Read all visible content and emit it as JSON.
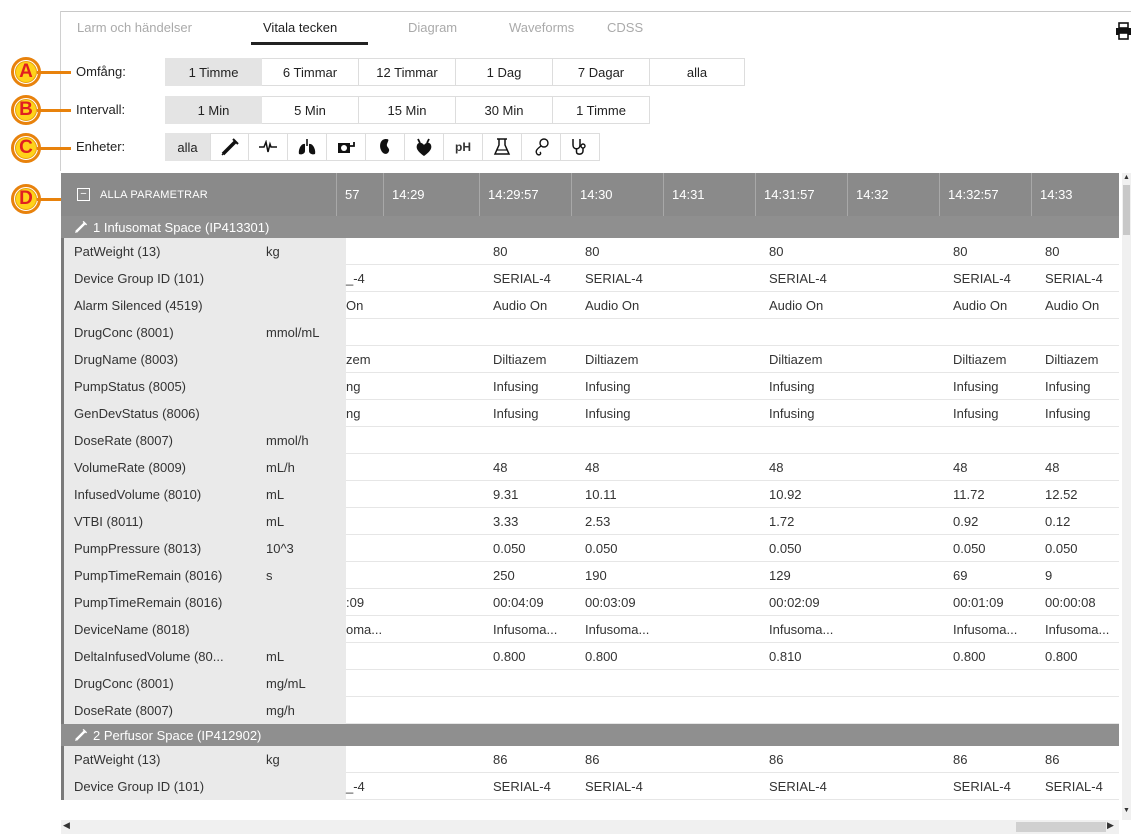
{
  "tabs": [
    "Larm och händelser",
    "Vitala tecken",
    "Diagram",
    "Waveforms",
    "CDSS"
  ],
  "active_tab": "Vitala tecken",
  "callouts": [
    "A",
    "B",
    "C",
    "D"
  ],
  "range": {
    "label": "Omfång:",
    "options": [
      "1 Timme",
      "6 Timmar",
      "12 Timmar",
      "1 Dag",
      "7 Dagar",
      "alla"
    ],
    "selected": "1 Timme"
  },
  "interval": {
    "label": "Intervall:",
    "options": [
      "1 Min",
      "5 Min",
      "15 Min",
      "30 Min",
      "1 Timme"
    ],
    "selected": "1 Min"
  },
  "units": {
    "label": "Enheter:",
    "all_label": "alla",
    "icons": [
      "syringe-icon",
      "ecg-icon",
      "lungs-icon",
      "ventilator-icon",
      "kidney-icon",
      "heart-icon",
      "ph-icon",
      "lab-flask-icon",
      "infusion-icon",
      "stethoscope-icon"
    ],
    "ph_text": "pH"
  },
  "grid_header": {
    "all_label": "ALLA PARAMETRAR",
    "columns": [
      "57",
      "14:29",
      "14:29:57",
      "14:30",
      "14:31",
      "14:31:57",
      "14:32",
      "14:32:57",
      "14:33"
    ]
  },
  "groups": [
    {
      "title": "1 Infusomat Space (IP413301)",
      "rows": [
        {
          "name": "PatWeight (13)",
          "unit": "kg",
          "values": [
            "",
            "80",
            "80",
            "",
            "80",
            "",
            "80",
            "80"
          ]
        },
        {
          "name": "Device Group ID (101)",
          "unit": "",
          "values": [
            "_-4",
            "SERIAL-4",
            "SERIAL-4",
            "",
            "SERIAL-4",
            "",
            "SERIAL-4",
            "SERIAL-4"
          ]
        },
        {
          "name": "Alarm Silenced (4519)",
          "unit": "",
          "values": [
            "On",
            "Audio On",
            "Audio On",
            "",
            "Audio On",
            "",
            "Audio On",
            "Audio On"
          ]
        },
        {
          "name": "DrugConc (8001)",
          "unit": "mmol/mL",
          "values": [
            "",
            "",
            "",
            "",
            "",
            "",
            "",
            ""
          ]
        },
        {
          "name": "DrugName (8003)",
          "unit": "",
          "values": [
            "zem",
            "Diltiazem",
            "Diltiazem",
            "",
            "Diltiazem",
            "",
            "Diltiazem",
            "Diltiazem"
          ]
        },
        {
          "name": "PumpStatus (8005)",
          "unit": "",
          "values": [
            "ng",
            "Infusing",
            "Infusing",
            "",
            "Infusing",
            "",
            "Infusing",
            "Infusing"
          ]
        },
        {
          "name": "GenDevStatus (8006)",
          "unit": "",
          "values": [
            "ng",
            "Infusing",
            "Infusing",
            "",
            "Infusing",
            "",
            "Infusing",
            "Infusing"
          ]
        },
        {
          "name": "DoseRate (8007)",
          "unit": "mmol/h",
          "values": [
            "",
            "",
            "",
            "",
            "",
            "",
            "",
            ""
          ]
        },
        {
          "name": "VolumeRate (8009)",
          "unit": "mL/h",
          "values": [
            "",
            "48",
            "48",
            "",
            "48",
            "",
            "48",
            "48"
          ]
        },
        {
          "name": "InfusedVolume (8010)",
          "unit": "mL",
          "values": [
            "",
            "9.31",
            "10.11",
            "",
            "10.92",
            "",
            "11.72",
            "12.52"
          ]
        },
        {
          "name": "VTBI (8011)",
          "unit": "mL",
          "values": [
            "",
            "3.33",
            "2.53",
            "",
            "1.72",
            "",
            "0.92",
            "0.12"
          ]
        },
        {
          "name": "PumpPressure (8013)",
          "unit": "10^3",
          "values": [
            "",
            "0.050",
            "0.050",
            "",
            "0.050",
            "",
            "0.050",
            "0.050"
          ]
        },
        {
          "name": "PumpTimeRemain (8016)",
          "unit": "s",
          "values": [
            "",
            "250",
            "190",
            "",
            "129",
            "",
            "69",
            "9"
          ]
        },
        {
          "name": "PumpTimeRemain (8016)",
          "unit": "",
          "values": [
            ":09",
            "00:04:09",
            "00:03:09",
            "",
            "00:02:09",
            "",
            "00:01:09",
            "00:00:08"
          ]
        },
        {
          "name": "DeviceName (8018)",
          "unit": "",
          "values": [
            "oma...",
            "Infusoma...",
            "Infusoma...",
            "",
            "Infusoma...",
            "",
            "Infusoma...",
            "Infusoma..."
          ]
        },
        {
          "name": "DeltaInfusedVolume (80...",
          "unit": "mL",
          "values": [
            "",
            "0.800",
            "0.800",
            "",
            "0.810",
            "",
            "0.800",
            "0.800"
          ]
        },
        {
          "name": "DrugConc (8001)",
          "unit": "mg/mL",
          "values": [
            "",
            "",
            "",
            "",
            "",
            "",
            "",
            ""
          ]
        },
        {
          "name": "DoseRate (8007)",
          "unit": "mg/h",
          "values": [
            "",
            "",
            "",
            "",
            "",
            "",
            "",
            ""
          ]
        }
      ]
    },
    {
      "title": "2 Perfusor Space (IP412902)",
      "rows": [
        {
          "name": "PatWeight (13)",
          "unit": "kg",
          "values": [
            "",
            "86",
            "86",
            "",
            "86",
            "",
            "86",
            "86"
          ]
        },
        {
          "name": "Device Group ID (101)",
          "unit": "",
          "values": [
            "_-4",
            "SERIAL-4",
            "SERIAL-4",
            "",
            "SERIAL-4",
            "",
            "SERIAL-4",
            "SERIAL-4"
          ]
        }
      ]
    }
  ]
}
